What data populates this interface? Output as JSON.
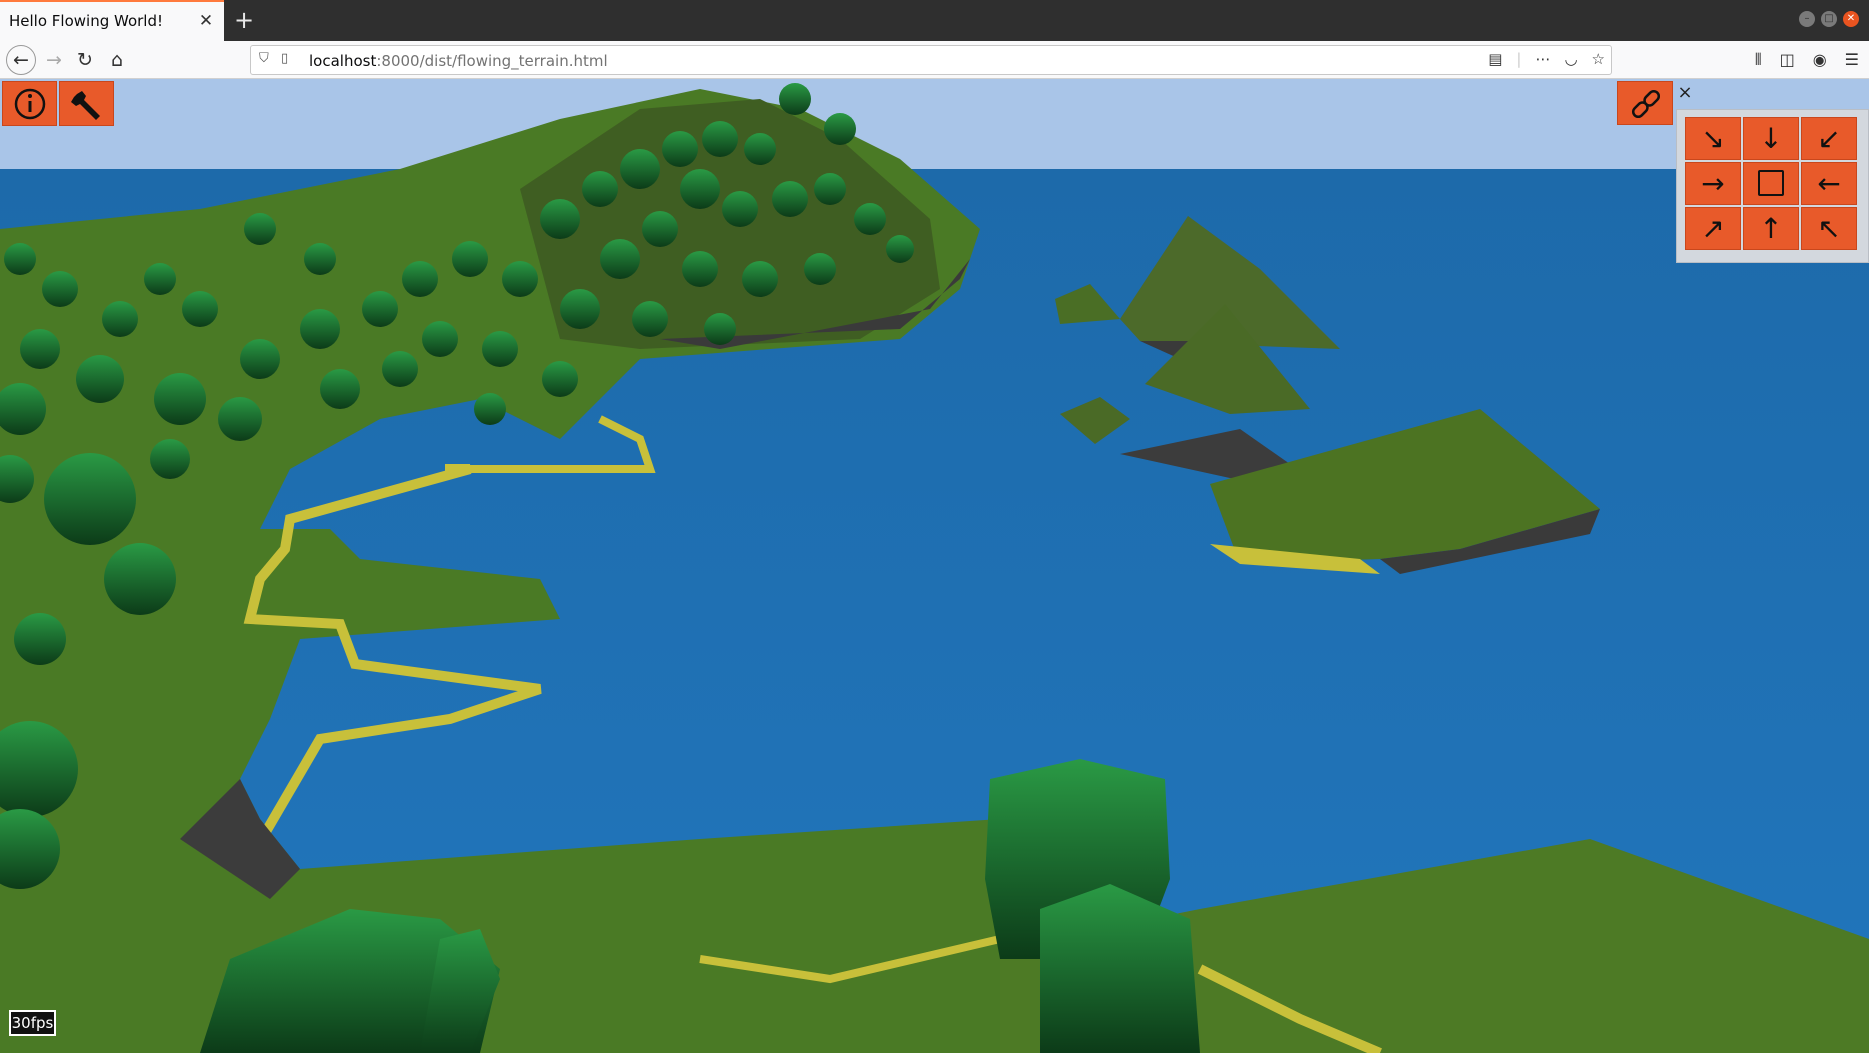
{
  "browser": {
    "tab_title": "Hello Flowing World!",
    "tab_close_icon": "close-icon",
    "new_tab_label": "+",
    "url_host": "localhost",
    "url_path": ":8000/dist/flowing_terrain.html",
    "window_controls": [
      "minimize",
      "maximize",
      "close"
    ]
  },
  "toolbar": {
    "info_icon": "info-icon",
    "settings_icon": "wrench-icon",
    "link_icon": "link-icon",
    "panel_close": "×"
  },
  "direction_pad": {
    "buttons": [
      {
        "id": "se",
        "glyph": "↘"
      },
      {
        "id": "s",
        "glyph": "↓"
      },
      {
        "id": "sw",
        "glyph": "↙"
      },
      {
        "id": "e",
        "glyph": "→"
      },
      {
        "id": "stop",
        "glyph": ""
      },
      {
        "id": "w",
        "glyph": "←"
      },
      {
        "id": "ne",
        "glyph": "↗"
      },
      {
        "id": "n",
        "glyph": "↑"
      },
      {
        "id": "nw",
        "glyph": "↖"
      }
    ]
  },
  "status": {
    "fps": "30fps"
  },
  "colors": {
    "accent": "#e85a2a",
    "sky": "#a9c5e8",
    "water": "#1f6fb3",
    "grass": "#3f6b1f",
    "sand": "#c8c03a",
    "tree": "#1f7a34"
  }
}
